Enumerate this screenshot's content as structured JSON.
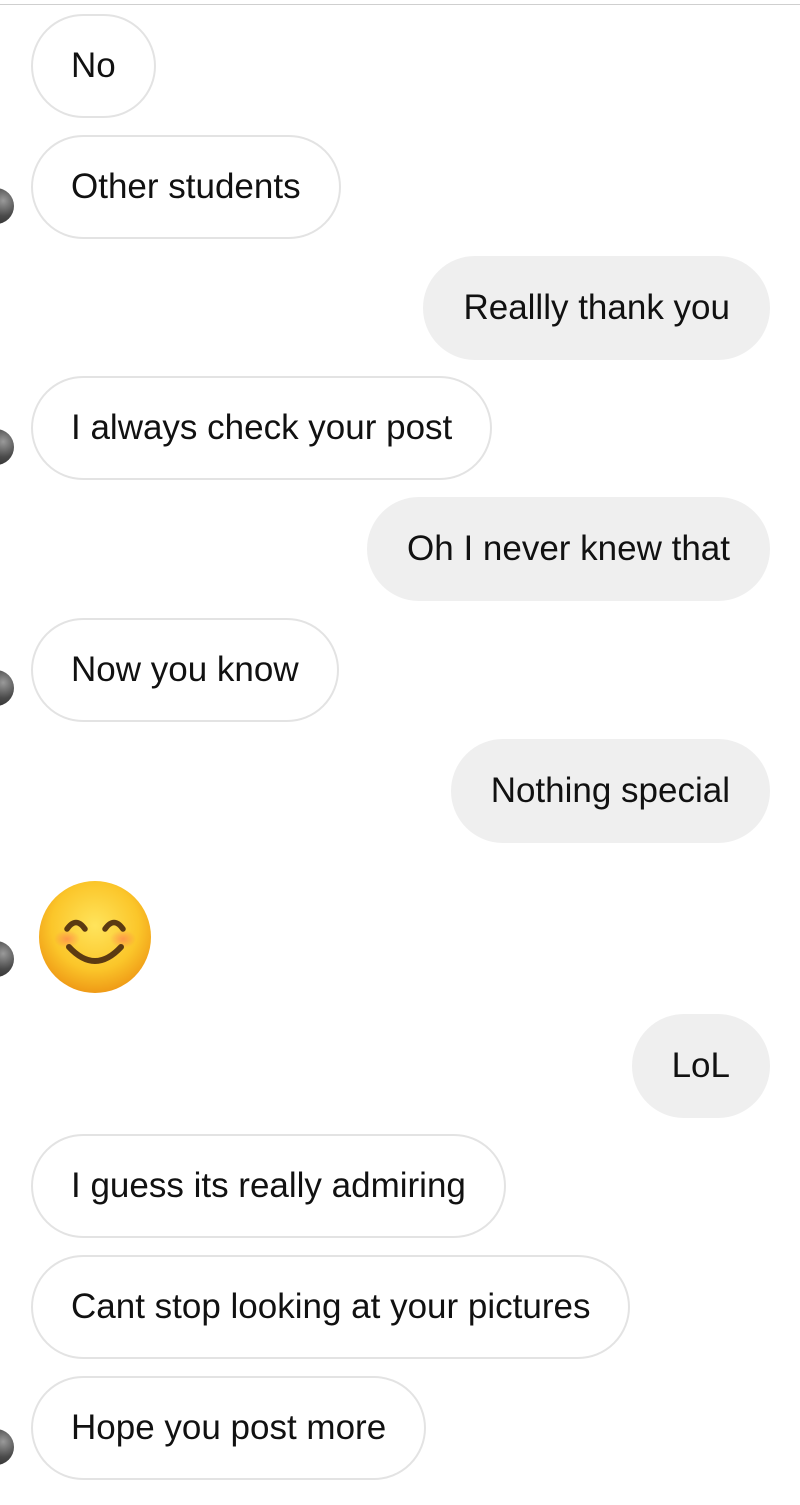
{
  "thread": {
    "messages": [
      {
        "from": "them",
        "text": "No",
        "avatar": false
      },
      {
        "from": "them",
        "text": "Other students",
        "avatar": true
      },
      {
        "from": "me",
        "text": "Reallly thank you"
      },
      {
        "from": "them",
        "text": "I always check your post",
        "avatar": true
      },
      {
        "from": "me",
        "text": "Oh I never knew that"
      },
      {
        "from": "them",
        "text": "Now you know",
        "avatar": true
      },
      {
        "from": "me",
        "text": "Nothing special"
      },
      {
        "from": "them",
        "emoji": "smiling-face-with-smiling-eyes",
        "avatar": true
      },
      {
        "from": "me",
        "text": "LoL"
      },
      {
        "from": "them",
        "text": "I guess its really admiring",
        "avatar": false
      },
      {
        "from": "them",
        "text": "Cant stop looking at your pictures",
        "avatar": false
      },
      {
        "from": "them",
        "text": "Hope you post more",
        "avatar": true
      }
    ]
  },
  "colors": {
    "incoming_bubble_bg": "#ffffff",
    "incoming_bubble_border": "#e3e3e3",
    "outgoing_bubble_bg": "#efefef",
    "text": "#111111"
  }
}
